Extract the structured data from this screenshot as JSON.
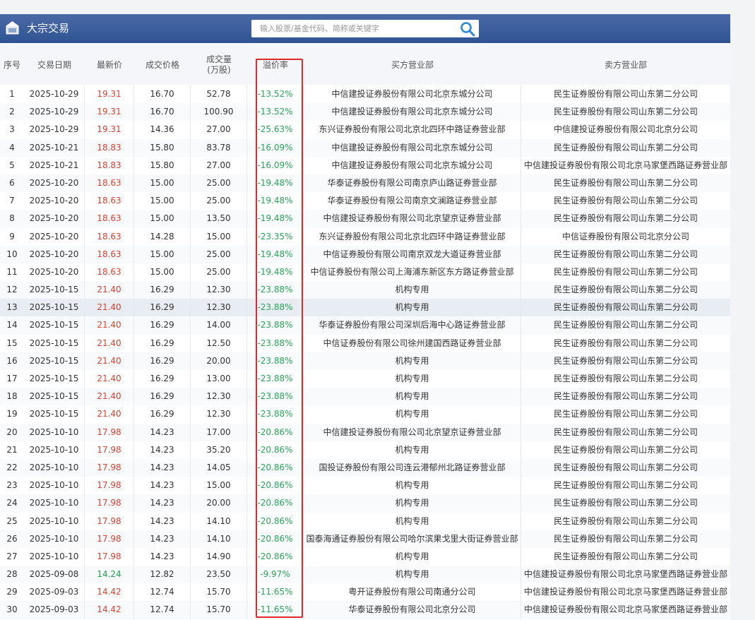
{
  "header": {
    "title": "大宗交易",
    "icon": "building-icon"
  },
  "search": {
    "placeholder": "输入股票/基金代码、简称或关键字",
    "icon": "search-icon"
  },
  "table": {
    "columns": [
      {
        "key": "seq",
        "label": "序号"
      },
      {
        "key": "date",
        "label": "交易日期"
      },
      {
        "key": "latest",
        "label": "最新价"
      },
      {
        "key": "price",
        "label": "成交价格"
      },
      {
        "key": "volume",
        "label": "成交量",
        "sub": "(万股)"
      },
      {
        "key": "premium",
        "label": "溢价率"
      },
      {
        "key": "buyer",
        "label": "买方营业部"
      },
      {
        "key": "seller",
        "label": "卖方营业部"
      }
    ],
    "highlighted_row": 13,
    "rows": [
      {
        "seq": "1",
        "date": "2025-10-29",
        "latest": "19.31",
        "latest_dir": "up",
        "price": "16.70",
        "volume": "52.78",
        "premium": "-13.52%",
        "buyer": "中信建投证券股份有限公司北京东城分公司",
        "seller": "民生证券股份有限公司山东第二分公司"
      },
      {
        "seq": "2",
        "date": "2025-10-29",
        "latest": "19.31",
        "latest_dir": "up",
        "price": "16.70",
        "volume": "100.90",
        "premium": "-13.52%",
        "buyer": "中信建投证券股份有限公司北京东城分公司",
        "seller": "民生证券股份有限公司山东第二分公司"
      },
      {
        "seq": "3",
        "date": "2025-10-29",
        "latest": "19.31",
        "latest_dir": "up",
        "price": "14.36",
        "volume": "27.00",
        "premium": "-25.63%",
        "buyer": "东兴证券股份有限公司北京北四环中路证券营业部",
        "seller": "中信建投证券股份有限公司北京分公司"
      },
      {
        "seq": "4",
        "date": "2025-10-21",
        "latest": "18.83",
        "latest_dir": "up",
        "price": "15.80",
        "volume": "83.78",
        "premium": "-16.09%",
        "buyer": "中信建投证券股份有限公司北京东城分公司",
        "seller": "民生证券股份有限公司山东第二分公司"
      },
      {
        "seq": "5",
        "date": "2025-10-21",
        "latest": "18.83",
        "latest_dir": "up",
        "price": "15.80",
        "volume": "27.00",
        "premium": "-16.09%",
        "buyer": "中信建投证券股份有限公司北京东城分公司",
        "seller": "中信建投证券股份有限公司北京马家堡西路证券营业部"
      },
      {
        "seq": "6",
        "date": "2025-10-20",
        "latest": "18.63",
        "latest_dir": "up",
        "price": "15.00",
        "volume": "25.00",
        "premium": "-19.48%",
        "buyer": "华泰证券股份有限公司南京庐山路证券营业部",
        "seller": "民生证券股份有限公司山东第二分公司"
      },
      {
        "seq": "7",
        "date": "2025-10-20",
        "latest": "18.63",
        "latest_dir": "up",
        "price": "15.00",
        "volume": "25.00",
        "premium": "-19.48%",
        "buyer": "华泰证券股份有限公司南京文澜路证券营业部",
        "seller": "民生证券股份有限公司山东第二分公司"
      },
      {
        "seq": "8",
        "date": "2025-10-20",
        "latest": "18.63",
        "latest_dir": "up",
        "price": "15.00",
        "volume": "13.50",
        "premium": "-19.48%",
        "buyer": "中信建投证券股份有限公司北京望京证券营业部",
        "seller": "民生证券股份有限公司山东第二分公司"
      },
      {
        "seq": "9",
        "date": "2025-10-20",
        "latest": "18.63",
        "latest_dir": "up",
        "price": "14.28",
        "volume": "15.00",
        "premium": "-23.35%",
        "buyer": "东兴证券股份有限公司北京北四环中路证券营业部",
        "seller": "中信证券股份有限公司北京分公司"
      },
      {
        "seq": "10",
        "date": "2025-10-20",
        "latest": "18.63",
        "latest_dir": "up",
        "price": "15.00",
        "volume": "25.00",
        "premium": "-19.48%",
        "buyer": "中信证券股份有限公司南京双龙大道证券营业部",
        "seller": "民生证券股份有限公司山东第二分公司"
      },
      {
        "seq": "11",
        "date": "2025-10-20",
        "latest": "18.63",
        "latest_dir": "up",
        "price": "15.00",
        "volume": "25.00",
        "premium": "-19.48%",
        "buyer": "中信证券股份有限公司上海浦东新区东方路证券营业部",
        "seller": "民生证券股份有限公司山东第二分公司"
      },
      {
        "seq": "12",
        "date": "2025-10-15",
        "latest": "21.40",
        "latest_dir": "up",
        "price": "16.29",
        "volume": "12.30",
        "premium": "-23.88%",
        "buyer": "机构专用",
        "seller": "民生证券股份有限公司山东第二分公司"
      },
      {
        "seq": "13",
        "date": "2025-10-15",
        "latest": "21.40",
        "latest_dir": "up",
        "price": "16.29",
        "volume": "12.30",
        "premium": "-23.88%",
        "buyer": "机构专用",
        "seller": "民生证券股份有限公司山东第二分公司"
      },
      {
        "seq": "14",
        "date": "2025-10-15",
        "latest": "21.40",
        "latest_dir": "up",
        "price": "16.29",
        "volume": "14.00",
        "premium": "-23.88%",
        "buyer": "华泰证券股份有限公司深圳后海中心路证券营业部",
        "seller": "民生证券股份有限公司山东第二分公司"
      },
      {
        "seq": "15",
        "date": "2025-10-15",
        "latest": "21.40",
        "latest_dir": "up",
        "price": "16.29",
        "volume": "12.50",
        "premium": "-23.88%",
        "buyer": "中信证券股份有限公司徐州建国西路证券营业部",
        "seller": "民生证券股份有限公司山东第二分公司"
      },
      {
        "seq": "16",
        "date": "2025-10-15",
        "latest": "21.40",
        "latest_dir": "up",
        "price": "16.29",
        "volume": "20.00",
        "premium": "-23.88%",
        "buyer": "机构专用",
        "seller": "民生证券股份有限公司山东第二分公司"
      },
      {
        "seq": "17",
        "date": "2025-10-15",
        "latest": "21.40",
        "latest_dir": "up",
        "price": "16.29",
        "volume": "13.00",
        "premium": "-23.88%",
        "buyer": "机构专用",
        "seller": "民生证券股份有限公司山东第二分公司"
      },
      {
        "seq": "18",
        "date": "2025-10-15",
        "latest": "21.40",
        "latest_dir": "up",
        "price": "16.29",
        "volume": "12.30",
        "premium": "-23.88%",
        "buyer": "机构专用",
        "seller": "民生证券股份有限公司山东第二分公司"
      },
      {
        "seq": "19",
        "date": "2025-10-15",
        "latest": "21.40",
        "latest_dir": "up",
        "price": "16.29",
        "volume": "12.30",
        "premium": "-23.88%",
        "buyer": "机构专用",
        "seller": "民生证券股份有限公司山东第二分公司"
      },
      {
        "seq": "20",
        "date": "2025-10-10",
        "latest": "17.98",
        "latest_dir": "up",
        "price": "14.23",
        "volume": "17.00",
        "premium": "-20.86%",
        "buyer": "中信建投证券股份有限公司北京望京证券营业部",
        "seller": "民生证券股份有限公司山东第二分公司"
      },
      {
        "seq": "21",
        "date": "2025-10-10",
        "latest": "17.98",
        "latest_dir": "up",
        "price": "14.23",
        "volume": "35.20",
        "premium": "-20.86%",
        "buyer": "机构专用",
        "seller": "民生证券股份有限公司山东第二分公司"
      },
      {
        "seq": "22",
        "date": "2025-10-10",
        "latest": "17.98",
        "latest_dir": "up",
        "price": "14.23",
        "volume": "14.05",
        "premium": "-20.86%",
        "buyer": "国投证券股份有限公司连云港郁州北路证券营业部",
        "seller": "民生证券股份有限公司山东第二分公司"
      },
      {
        "seq": "23",
        "date": "2025-10-10",
        "latest": "17.98",
        "latest_dir": "up",
        "price": "14.23",
        "volume": "15.00",
        "premium": "-20.86%",
        "buyer": "机构专用",
        "seller": "民生证券股份有限公司山东第二分公司"
      },
      {
        "seq": "24",
        "date": "2025-10-10",
        "latest": "17.98",
        "latest_dir": "up",
        "price": "14.23",
        "volume": "20.00",
        "premium": "-20.86%",
        "buyer": "机构专用",
        "seller": "民生证券股份有限公司山东第二分公司"
      },
      {
        "seq": "25",
        "date": "2025-10-10",
        "latest": "17.98",
        "latest_dir": "up",
        "price": "14.23",
        "volume": "14.10",
        "premium": "-20.86%",
        "buyer": "机构专用",
        "seller": "民生证券股份有限公司山东第二分公司"
      },
      {
        "seq": "26",
        "date": "2025-10-10",
        "latest": "17.98",
        "latest_dir": "up",
        "price": "14.23",
        "volume": "14.10",
        "premium": "-20.86%",
        "buyer": "国泰海通证券股份有限公司哈尔滨果戈里大街证券营业部",
        "seller": "民生证券股份有限公司山东第二分公司"
      },
      {
        "seq": "27",
        "date": "2025-10-10",
        "latest": "17.98",
        "latest_dir": "up",
        "price": "14.23",
        "volume": "14.90",
        "premium": "-20.86%",
        "buyer": "机构专用",
        "seller": "民生证券股份有限公司山东第二分公司"
      },
      {
        "seq": "28",
        "date": "2025-09-08",
        "latest": "14.24",
        "latest_dir": "flat",
        "price": "12.82",
        "volume": "23.50",
        "premium": "-9.97%",
        "buyer": "机构专用",
        "seller": "中信建投证券股份有限公司北京马家堡西路证券营业部"
      },
      {
        "seq": "29",
        "date": "2025-09-03",
        "latest": "14.42",
        "latest_dir": "up",
        "price": "12.74",
        "volume": "15.70",
        "premium": "-11.65%",
        "buyer": "粤开证券股份有限公司南通分公司",
        "seller": "中信建投证券股份有限公司北京马家堡西路证券营业部"
      },
      {
        "seq": "30",
        "date": "2025-09-03",
        "latest": "14.42",
        "latest_dir": "up",
        "price": "12.74",
        "volume": "15.70",
        "premium": "-11.65%",
        "buyer": "华泰证券股份有限公司北京分公司",
        "seller": "中信建投证券股份有限公司北京马家堡西路证券营业部"
      }
    ]
  },
  "colors": {
    "header_bg": "#2f5392",
    "price_up": "#e23f2e",
    "price_flat": "#1ea04a",
    "premium": "#2aa558",
    "annotation": "#e0292e"
  }
}
